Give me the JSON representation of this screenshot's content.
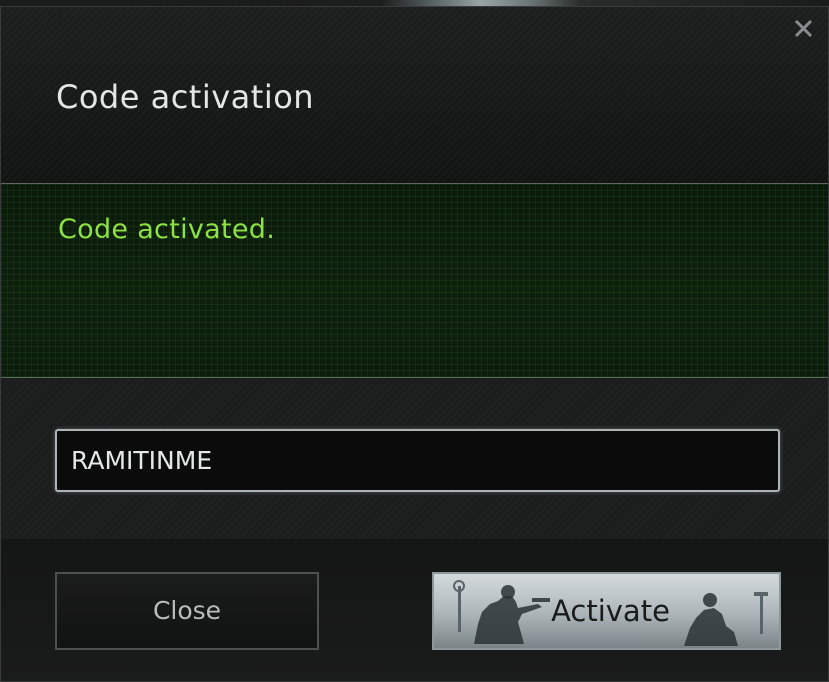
{
  "dialog": {
    "title": "Code activation",
    "close_icon": "close-x-icon"
  },
  "status": {
    "message": "Code activated.",
    "color": "#8ee142"
  },
  "code_field": {
    "value": "RAMITINME",
    "placeholder": ""
  },
  "buttons": {
    "close_label": "Close",
    "activate_label": "Activate"
  },
  "colors": {
    "background": "#1a1b1b",
    "accent_green": "#8ee142",
    "input_border": "#aab3b6"
  }
}
